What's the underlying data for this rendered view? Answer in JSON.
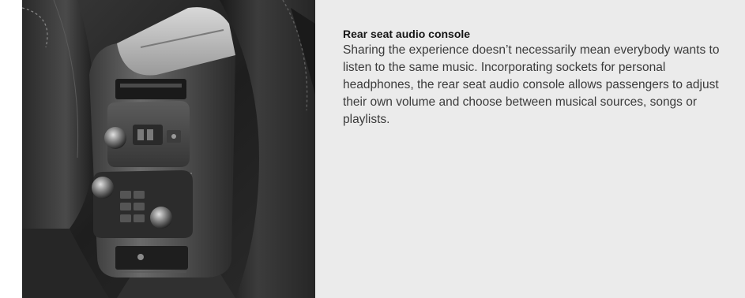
{
  "article": {
    "heading": "Rear seat audio console",
    "body": "Sharing the experience doesn’t necessarily mean everybody wants to listen to the same music. Incorporating sockets for personal headphones, the rear seat audio console allows passengers to adjust their own volume and choose between musical sources, songs or playlists."
  }
}
